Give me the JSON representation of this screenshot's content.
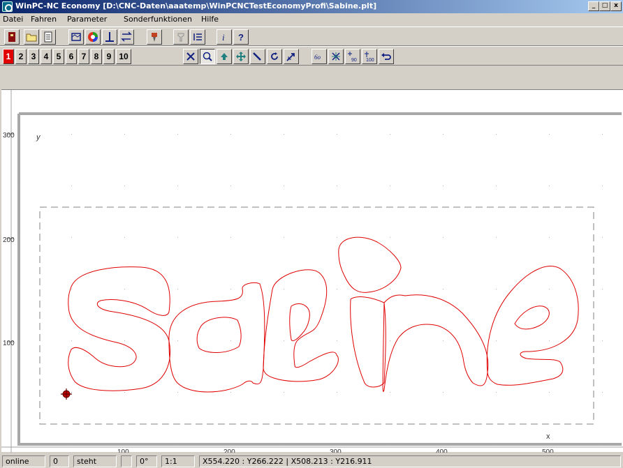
{
  "window": {
    "title": "WinPC-NC Economy [D:\\CNC-Daten\\aaatemp\\WinPCNCTestEconomyProfi\\Sabine.plt]",
    "minimize": "_",
    "maximize": "□",
    "close": "x"
  },
  "menu": [
    "Datei",
    "Fahren",
    "Parameter",
    "Sonderfunktionen",
    "Hilfe"
  ],
  "numbers": [
    "1",
    "2",
    "3",
    "4",
    "5",
    "6",
    "7",
    "8",
    "9",
    "10"
  ],
  "toolbar_icons": {
    "row1": [
      "exit-icon",
      "open-folder-icon",
      "document-icon",
      "frame-icon",
      "color-wheel-icon",
      "reference-icon",
      "swap-icon",
      "tool-icon",
      "tool-disabled-icon",
      "list-icon",
      "info-icon",
      "help-icon"
    ],
    "row2": [
      "clear-icon",
      "zoom-icon",
      "up-icon",
      "move-icon",
      "diagonal-icon",
      "rotate-icon",
      "origin-icon",
      "glasses-icon",
      "cross-icon",
      "rotate-90-icon",
      "scale-100-icon",
      "undo-icon"
    ]
  },
  "icon_labels": {
    "help": "?",
    "info": "i",
    "rot90": "90",
    "scale100": "100",
    "glasses": "6o"
  },
  "plot": {
    "y_label": "y",
    "x_label": "x",
    "y_ticks": [
      "300",
      "200",
      "100"
    ],
    "x_ticks": [
      "100",
      "200",
      "300",
      "400",
      "500"
    ],
    "shape_color": "#e00000",
    "grid_color": "#b0b0b0"
  },
  "status": {
    "state": "online",
    "count": "0",
    "motion": "steht",
    "blank": "",
    "angle": "0°",
    "scale": "1:1",
    "coords": "X554.220 : Y266.222  |  X508.213 : Y216.911"
  }
}
